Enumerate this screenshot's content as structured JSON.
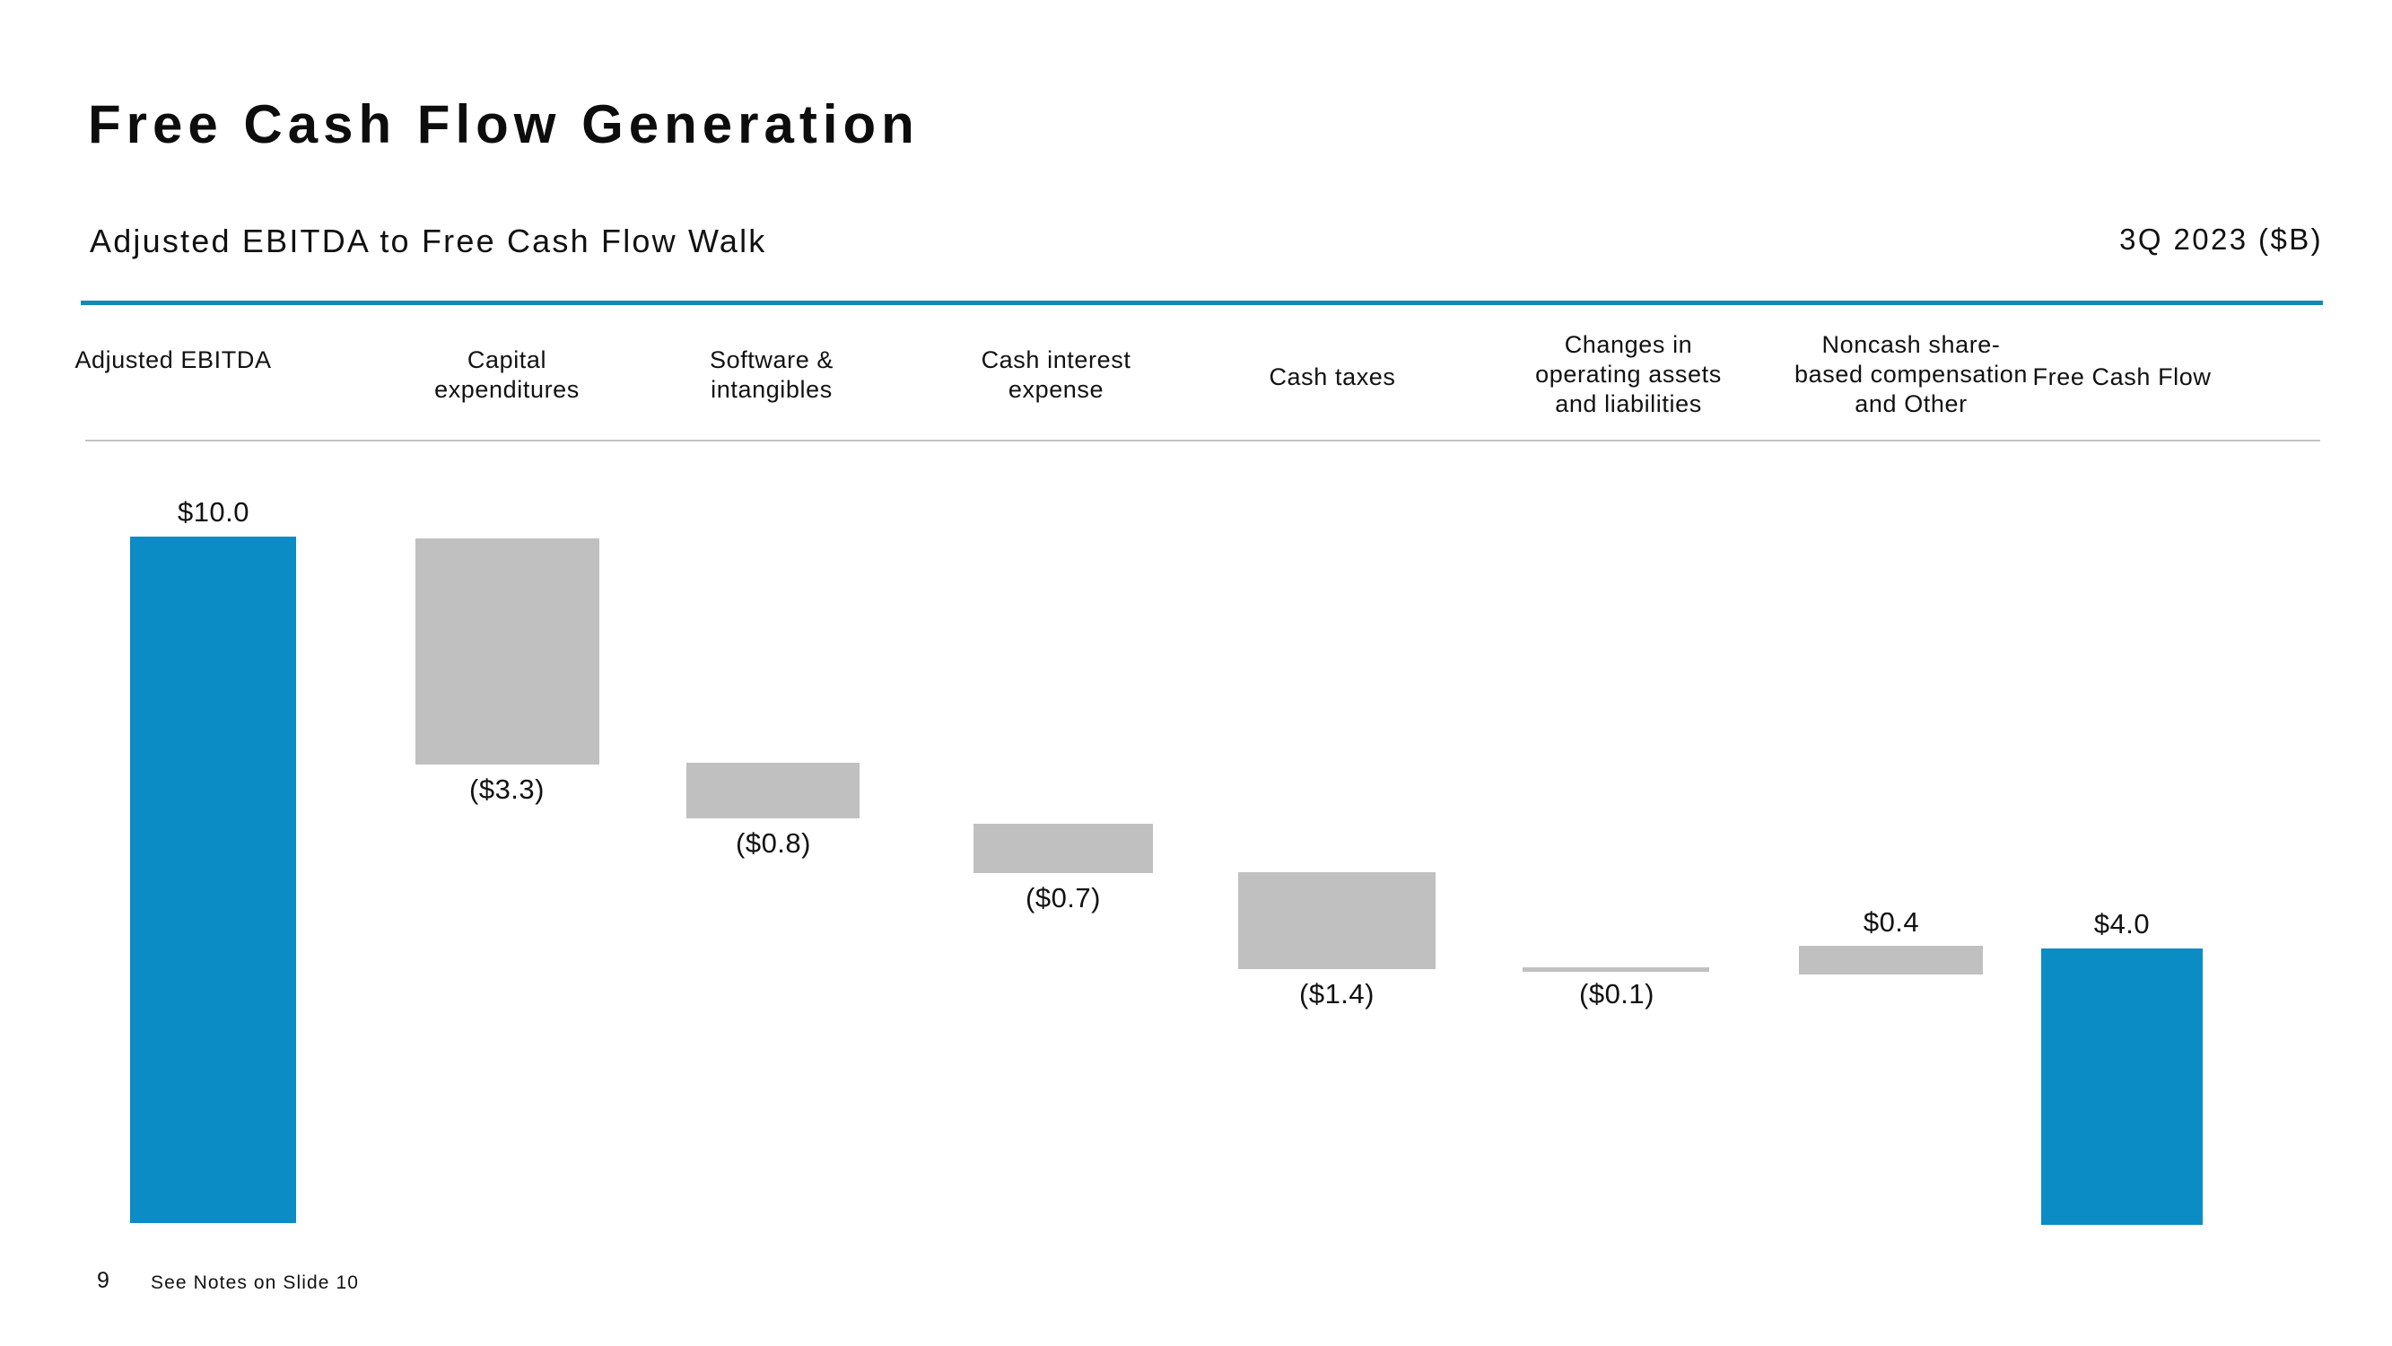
{
  "slide": {
    "title": "Free Cash Flow Generation",
    "subtitle": "Adjusted EBITDA to Free Cash Flow Walk",
    "period": "3Q 2023 ($B)",
    "page_number": "9",
    "footnote": "See Notes on Slide 10",
    "accent_color": "#118ab5",
    "total_bar_color": "#0b8cc4",
    "delta_bar_color": "#c0c0c0"
  },
  "chart_data": {
    "type": "bar",
    "chart_style": "waterfall",
    "title": "Adjusted EBITDA to Free Cash Flow Walk",
    "subtitle": "3Q 2023 ($B)",
    "xlabel": "",
    "ylabel": "",
    "units": "$B",
    "grid": false,
    "legend": "none",
    "baseline": 0.0,
    "ylim": [
      0,
      10
    ],
    "categories": [
      "Adjusted EBITDA",
      "Capital expenditures",
      "Software & intangibles",
      "Cash interest expense",
      "Cash taxes",
      "Changes in operating assets and liabilities",
      "Noncash share-based compensation and Other",
      "Free Cash Flow"
    ],
    "values": [
      10.0,
      -3.3,
      -0.8,
      -0.7,
      -1.4,
      -0.1,
      0.4,
      4.0
    ],
    "labels": [
      "$10.0",
      "($3.3)",
      "($0.8)",
      "($0.7)",
      "($1.4)",
      "($0.1)",
      "$0.4",
      "$4.0"
    ],
    "kinds": [
      "total",
      "delta",
      "delta",
      "delta",
      "delta",
      "delta",
      "delta",
      "total"
    ],
    "cumulative_start": [
      0.0,
      10.0,
      6.7,
      5.9,
      5.2,
      3.8,
      3.7,
      0.0
    ],
    "cumulative_end": [
      10.0,
      6.7,
      5.9,
      5.2,
      3.8,
      3.7,
      4.1,
      4.0
    ]
  },
  "columns": [
    {
      "lines": [
        "Adjusted EBITDA"
      ],
      "label": "$10.0",
      "label_position": "above"
    },
    {
      "lines": [
        "Capital",
        "expenditures"
      ],
      "label": "($3.3)",
      "label_position": "below"
    },
    {
      "lines": [
        "Software &",
        "intangibles"
      ],
      "label": "($0.8)",
      "label_position": "below"
    },
    {
      "lines": [
        "Cash interest",
        "expense"
      ],
      "label": "($0.7)",
      "label_position": "below"
    },
    {
      "lines": [
        "Cash taxes"
      ],
      "label": "($1.4)",
      "label_position": "below"
    },
    {
      "lines": [
        "Changes in",
        "operating assets",
        "and liabilities"
      ],
      "label": "($0.1)",
      "label_position": "below"
    },
    {
      "lines": [
        "Noncash share-",
        "based compensation",
        "and Other"
      ],
      "label": "$0.4",
      "label_position": "above"
    },
    {
      "lines": [
        "Free Cash Flow"
      ],
      "label": "$4.0",
      "label_position": "above"
    }
  ]
}
